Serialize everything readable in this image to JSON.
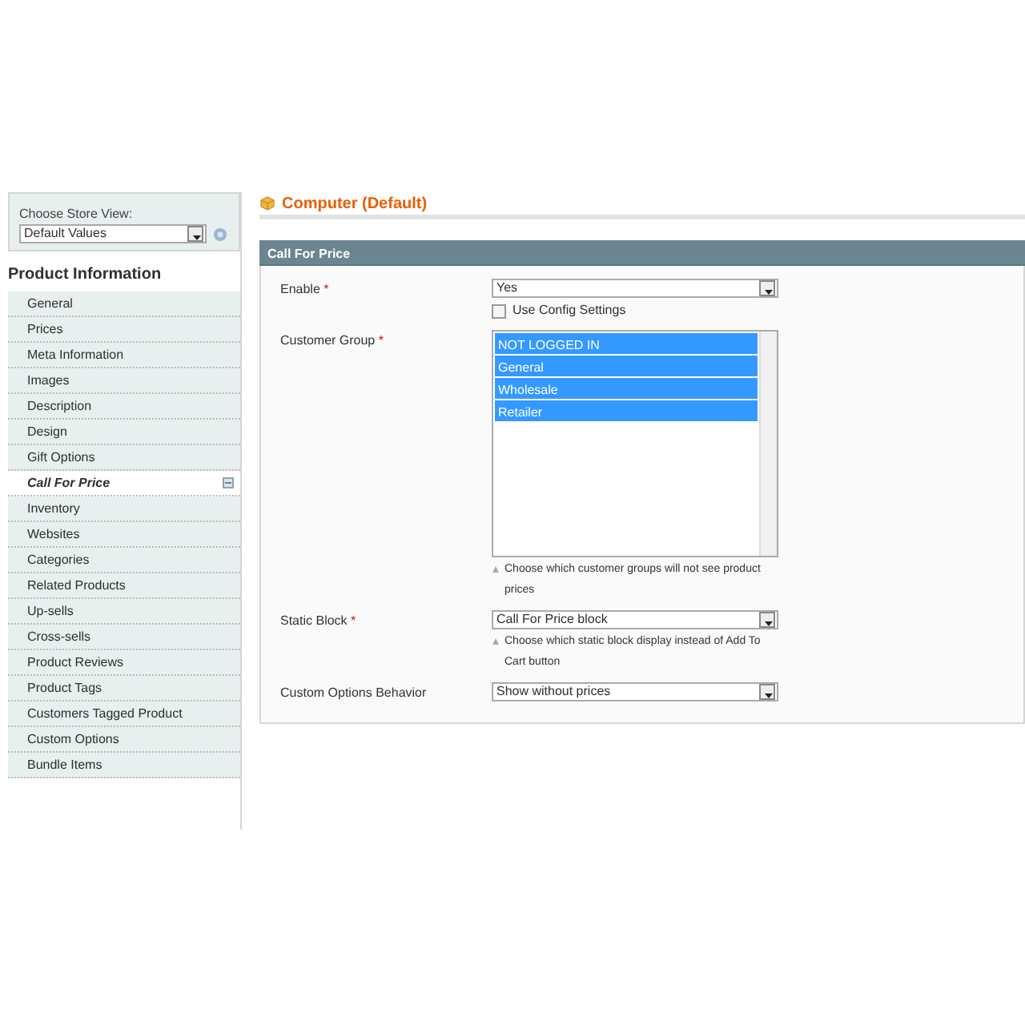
{
  "store_view": {
    "label": "Choose Store View:",
    "value": "Default Values"
  },
  "sidebar": {
    "title": "Product Information",
    "items": [
      {
        "label": "General",
        "selected": false
      },
      {
        "label": "Prices",
        "selected": false
      },
      {
        "label": "Meta Information",
        "selected": false
      },
      {
        "label": "Images",
        "selected": false
      },
      {
        "label": "Description",
        "selected": false
      },
      {
        "label": "Design",
        "selected": false
      },
      {
        "label": "Gift Options",
        "selected": false
      },
      {
        "label": "Call For Price",
        "selected": true
      },
      {
        "label": "Inventory",
        "selected": false
      },
      {
        "label": "Websites",
        "selected": false
      },
      {
        "label": "Categories",
        "selected": false
      },
      {
        "label": "Related Products",
        "selected": false
      },
      {
        "label": "Up-sells",
        "selected": false
      },
      {
        "label": "Cross-sells",
        "selected": false
      },
      {
        "label": "Product Reviews",
        "selected": false
      },
      {
        "label": "Product Tags",
        "selected": false
      },
      {
        "label": "Customers Tagged Product",
        "selected": false
      },
      {
        "label": "Custom Options",
        "selected": false
      },
      {
        "label": "Bundle Items",
        "selected": false
      }
    ]
  },
  "page_title": "Computer (Default)",
  "fieldset": {
    "title": "Call For Price",
    "fields": [
      {
        "kind": "select",
        "label": "Enable",
        "required_mark": "*",
        "value": "Yes",
        "use_config": {
          "label": "Use Config Settings",
          "checked": false
        }
      },
      {
        "kind": "multiselect",
        "label": "Customer Group",
        "required_mark": "*",
        "options": [
          {
            "label": "NOT LOGGED IN",
            "selected": true
          },
          {
            "label": "General",
            "selected": true
          },
          {
            "label": "Wholesale",
            "selected": true
          },
          {
            "label": "Retailer",
            "selected": true
          }
        ],
        "note": "Choose which customer groups will not see product prices"
      },
      {
        "kind": "select",
        "label": "Static Block",
        "required_mark": "*",
        "value": "Call For Price block",
        "note": "Choose which static block display instead of Add To Cart button"
      },
      {
        "kind": "select",
        "label": "Custom Options Behavior",
        "value": "Show without prices"
      }
    ]
  }
}
